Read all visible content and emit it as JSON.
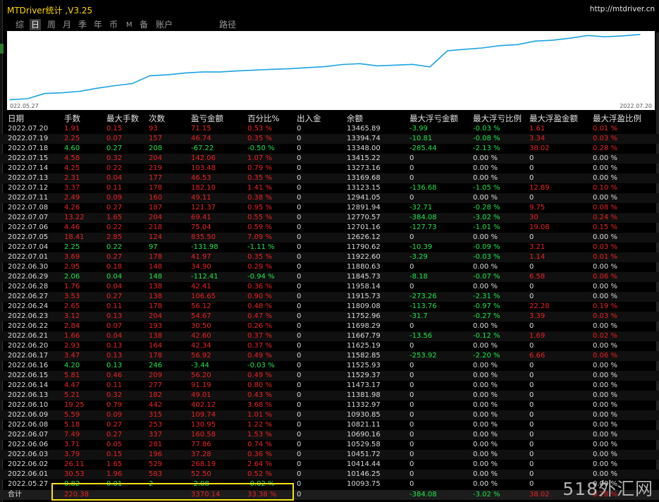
{
  "app": {
    "title": "MTDriver统计 ,V3.25",
    "url": "http://mtdriver.cn"
  },
  "tabs": [
    {
      "label": "综",
      "active": false,
      "small": false
    },
    {
      "label": "日",
      "active": true,
      "small": false
    },
    {
      "label": "周",
      "active": false,
      "small": false
    },
    {
      "label": "月",
      "active": false,
      "small": false
    },
    {
      "label": "季",
      "active": false,
      "small": false
    },
    {
      "label": "年",
      "active": false,
      "small": false
    },
    {
      "label": "币",
      "active": false,
      "small": false
    },
    {
      "label": "M",
      "active": false,
      "small": true
    },
    {
      "label": "备",
      "active": false,
      "small": false
    },
    {
      "label": "账户",
      "active": false,
      "small": false
    },
    {
      "label": "路径",
      "active": false,
      "small": false
    }
  ],
  "chart": {
    "start_date": "022.05.27",
    "end_date": "2022.07.20",
    "line_color": "#1aa3e0"
  },
  "chart_data": {
    "type": "line",
    "x": [
      "2022.05.27",
      "2022.06.01",
      "2022.06.02",
      "2022.06.03",
      "2022.06.06",
      "2022.06.07",
      "2022.06.08",
      "2022.06.09",
      "2022.06.10",
      "2022.06.13",
      "2022.06.14",
      "2022.06.15",
      "2022.06.16",
      "2022.06.17",
      "2022.06.20",
      "2022.06.21",
      "2022.06.22",
      "2022.06.23",
      "2022.06.24",
      "2022.06.27",
      "2022.06.28",
      "2022.06.29",
      "2022.06.30",
      "2022.07.01",
      "2022.07.04",
      "2022.07.05",
      "2022.07.06",
      "2022.07.07",
      "2022.07.08",
      "2022.07.11",
      "2022.07.12",
      "2022.07.13",
      "2022.07.14",
      "2022.07.15",
      "2022.07.18",
      "2022.07.19",
      "2022.07.20"
    ],
    "series": [
      {
        "values": [
          10093.75,
          10146.25,
          10414.44,
          10451.72,
          10529.58,
          10690.16,
          10821.11,
          10930.85,
          11332.97,
          11381.98,
          11473.17,
          11529.37,
          11525.93,
          11582.85,
          11625.19,
          11667.79,
          11698.29,
          11752.96,
          11809.08,
          11915.73,
          11958.14,
          11845.73,
          11880.63,
          11922.6,
          11790.62,
          12626.12,
          12701.16,
          12770.57,
          12891.94,
          12941.05,
          13123.15,
          13169.68,
          13273.16,
          13415.22,
          13348.0,
          13394.74,
          13465.89
        ]
      }
    ]
  },
  "columns": [
    "日期",
    "手数",
    "最大手数",
    "次数",
    "盈亏金额",
    "百分比%",
    "出入金",
    "余额",
    "最大浮亏金额",
    "最大浮亏比例",
    "最大浮盈金额",
    "最大浮盈比例"
  ],
  "rows": [
    [
      "2022.07.20",
      "1.91",
      "0.15",
      "93",
      "71.15",
      "0.53 %",
      "0",
      "13465.89",
      "-3.99",
      "-0.03 %",
      "1.61",
      "0.01 %"
    ],
    [
      "2022.07.19",
      "2.25",
      "0.07",
      "157",
      "46.74",
      "0.35 %",
      "0",
      "13394.74",
      "-10.81",
      "-0.08 %",
      "3.34",
      "0.03 %"
    ],
    [
      "2022.07.18",
      "4.60",
      "0.27",
      "208",
      "-67.22",
      "-0.50 %",
      "0",
      "13348.00",
      "-285.44",
      "-2.13 %",
      "38.02",
      "0.28 %"
    ],
    [
      "2022.07.15",
      "4.58",
      "0.32",
      "204",
      "142.06",
      "1.07 %",
      "0",
      "13415.22",
      "0",
      "0.00 %",
      "0",
      "0.00 %"
    ],
    [
      "2022.07.14",
      "4.25",
      "0.22",
      "219",
      "103.48",
      "0.79 %",
      "0",
      "13273.16",
      "0",
      "0.00 %",
      "0",
      "0.00 %"
    ],
    [
      "2022.07.13",
      "2.31",
      "0.04",
      "177",
      "46.53",
      "0.35 %",
      "0",
      "13169.68",
      "0",
      "0.00 %",
      "0",
      "0.00 %"
    ],
    [
      "2022.07.12",
      "3.37",
      "0.11",
      "178",
      "182.10",
      "1.41 %",
      "0",
      "13123.15",
      "-136.68",
      "-1.05 %",
      "12.89",
      "0.10 %"
    ],
    [
      "2022.07.11",
      "2.49",
      "0.09",
      "160",
      "49.11",
      "0.38 %",
      "0",
      "12941.05",
      "0",
      "0.00 %",
      "0",
      "0.00 %"
    ],
    [
      "2022.07.08",
      "4.26",
      "0.27",
      "187",
      "121.37",
      "0.95 %",
      "0",
      "12891.94",
      "-32.71",
      "-0.28 %",
      "9.75",
      "0.08 %"
    ],
    [
      "2022.07.07",
      "13.22",
      "1.65",
      "204",
      "69.41",
      "0.55 %",
      "0",
      "12770.57",
      "-384.08",
      "-3.02 %",
      "30",
      "0.24 %"
    ],
    [
      "2022.07.06",
      "4.46",
      "0.22",
      "218",
      "75.04",
      "0.59 %",
      "0",
      "12701.16",
      "-127.73",
      "-1.01 %",
      "19.08",
      "0.15 %"
    ],
    [
      "2022.07.05",
      "18.41",
      "2.85",
      "124",
      "835.50",
      "7.09 %",
      "0",
      "12626.12",
      "0",
      "0.00 %",
      "0",
      "0.00 %"
    ],
    [
      "2022.07.04",
      "2.25",
      "0.22",
      "97",
      "-131.98",
      "-1.11 %",
      "0",
      "11790.62",
      "-10.39",
      "-0.09 %",
      "3.21",
      "0.03 %"
    ],
    [
      "2022.07.01",
      "3.69",
      "0.27",
      "178",
      "41.97",
      "0.35 %",
      "0",
      "11922.60",
      "-3.29",
      "-0.03 %",
      "1.14",
      "0.01 %"
    ],
    [
      "2022.06.30",
      "2.95",
      "0.18",
      "148",
      "34.90",
      "0.29 %",
      "0",
      "11880.63",
      "0",
      "0.00 %",
      "0",
      "0.00 %"
    ],
    [
      "2022.06.29",
      "2.06",
      "0.04",
      "148",
      "-112.41",
      "-0.94 %",
      "0",
      "11845.73",
      "-8.18",
      "-0.07 %",
      "6.58",
      "0.06 %"
    ],
    [
      "2022.06.28",
      "1.76",
      "0.04",
      "138",
      "42.41",
      "0.36 %",
      "0",
      "11958.14",
      "0",
      "0.00 %",
      "0",
      "0.00 %"
    ],
    [
      "2022.06.27",
      "3.53",
      "0.27",
      "138",
      "106.65",
      "0.90 %",
      "0",
      "11915.73",
      "-273.26",
      "-2.31 %",
      "0",
      "0.00 %"
    ],
    [
      "2022.06.24",
      "2.65",
      "0.11",
      "178",
      "56.12",
      "0.48 %",
      "0",
      "11809.08",
      "-113.76",
      "-0.97 %",
      "22.28",
      "0.19 %"
    ],
    [
      "2022.06.23",
      "3.12",
      "0.13",
      "204",
      "54.67",
      "0.47 %",
      "0",
      "11752.96",
      "-31.7",
      "-0.27 %",
      "3.39",
      "0.03 %"
    ],
    [
      "2022.06.22",
      "2.84",
      "0.07",
      "193",
      "30.50",
      "0.26 %",
      "0",
      "11698.29",
      "0",
      "0.00 %",
      "0",
      "0.00 %"
    ],
    [
      "2022.06.21",
      "1.66",
      "0.04",
      "138",
      "42.60",
      "0.37 %",
      "0",
      "11667.79",
      "-13.56",
      "-0.12 %",
      "1.69",
      "0.02 %"
    ],
    [
      "2022.06.20",
      "2.93",
      "0.13",
      "164",
      "42.34",
      "0.37 %",
      "0",
      "11625.19",
      "0",
      "0.00 %",
      "0",
      "0.00 %"
    ],
    [
      "2022.06.17",
      "3.47",
      "0.13",
      "178",
      "56.92",
      "0.49 %",
      "0",
      "11582.85",
      "-253.92",
      "-2.20 %",
      "6.66",
      "0.06 %"
    ],
    [
      "2022.06.16",
      "4.20",
      "0.13",
      "246",
      "-3.44",
      "-0.03 %",
      "0",
      "11525.93",
      "0",
      "0.00 %",
      "0",
      "0.00 %"
    ],
    [
      "2022.06.15",
      "5.81",
      "0.46",
      "209",
      "56.20",
      "0.49 %",
      "0",
      "11529.37",
      "0",
      "0.00 %",
      "0",
      "0.00 %"
    ],
    [
      "2022.06.14",
      "4.47",
      "0.11",
      "277",
      "91.19",
      "0.80 %",
      "0",
      "11473.17",
      "0",
      "0.00 %",
      "0",
      "0.00 %"
    ],
    [
      "2022.06.13",
      "5.21",
      "0.32",
      "182",
      "49.01",
      "0.43 %",
      "0",
      "11381.98",
      "0",
      "0.00 %",
      "0",
      "0.00 %"
    ],
    [
      "2022.06.10",
      "19.25",
      "0.79",
      "442",
      "402.12",
      "3.68 %",
      "0",
      "11332.97",
      "0",
      "0.00 %",
      "0",
      "0.00 %"
    ],
    [
      "2022.06.09",
      "5.59",
      "0.09",
      "315",
      "109.74",
      "1.01 %",
      "0",
      "10930.85",
      "0",
      "0.00 %",
      "0",
      "0.00 %"
    ],
    [
      "2022.06.08",
      "5.18",
      "0.27",
      "253",
      "130.95",
      "1.22 %",
      "0",
      "10821.11",
      "0",
      "0.00 %",
      "0",
      "0.00 %"
    ],
    [
      "2022.06.07",
      "7.49",
      "0.27",
      "337",
      "160.58",
      "1.53 %",
      "0",
      "10690.16",
      "0",
      "0.00 %",
      "0",
      "0.00 %"
    ],
    [
      "2022.06.06",
      "3.71",
      "0.05",
      "281",
      "77.86",
      "0.74 %",
      "0",
      "10529.58",
      "0",
      "0.00 %",
      "0",
      "0.00 %"
    ],
    [
      "2022.06.03",
      "3.79",
      "0.15",
      "196",
      "37.28",
      "0.36 %",
      "0",
      "10451.72",
      "0",
      "0.00 %",
      "0",
      "0.00 %"
    ],
    [
      "2022.06.02",
      "26.11",
      "1.65",
      "529",
      "268.19",
      "2.64 %",
      "0",
      "10414.44",
      "0",
      "0.00 %",
      "0",
      "0.00 %"
    ],
    [
      "2022.06.01",
      "30.53",
      "1.96",
      "583",
      "52.50",
      "0.52 %",
      "0",
      "10146.25",
      "0",
      "0.00 %",
      "0",
      "0.00 %"
    ],
    [
      "2022.05.27",
      "0.82",
      "0.01",
      "2",
      "-2.08",
      "-0.02 %",
      "0",
      "10093.75",
      "0",
      "0.00 %",
      "0",
      "0.00 %"
    ]
  ],
  "total": [
    "合计",
    "220.38",
    "",
    "",
    "3370.14",
    "33.38 %",
    "0",
    "",
    "-384.08",
    "-3.02 %",
    "38.02",
    "0.28 %"
  ],
  "watermark": "518外汇网"
}
